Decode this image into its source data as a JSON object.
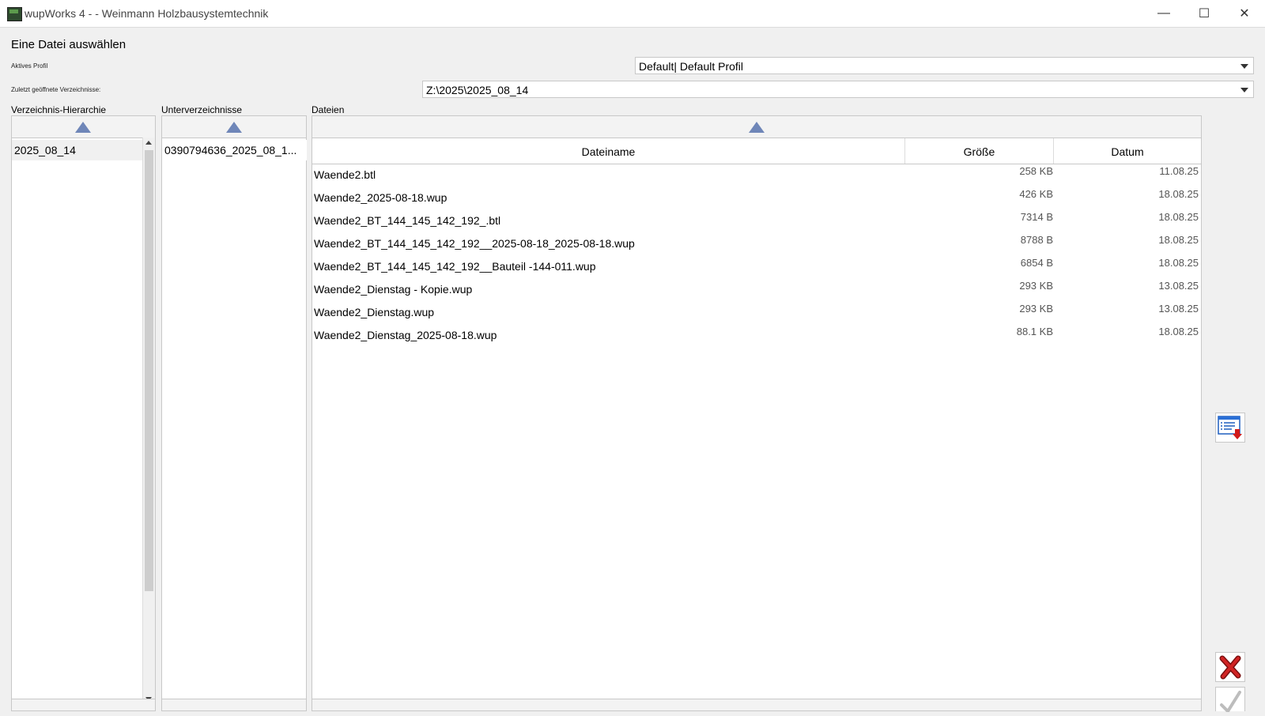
{
  "window": {
    "title": "wupWorks 4 -  - Weinmann Holzbausystemtechnik",
    "minimize_glyph": "—",
    "maximize_glyph": "☐",
    "close_glyph": "✕"
  },
  "dialog": {
    "title": "Eine Datei auswählen",
    "active_profile_label": "Aktives Profil",
    "active_profile_value": "Default| Default Profil",
    "recent_dirs_label": "Zuletzt geöffnete Verzeichnisse:",
    "recent_dir_value": "Z:\\2025\\2025_08_14"
  },
  "hierarchy": {
    "label": "Verzeichnis-Hierarchie",
    "items": [
      "2025_08_14"
    ]
  },
  "subdirs": {
    "label": "Unterverzeichnisse",
    "items": [
      "0390794636_2025_08_1..."
    ]
  },
  "files": {
    "label": "Dateien",
    "columns": {
      "name": "Dateiname",
      "size": "Größe",
      "date": "Datum"
    },
    "rows": [
      {
        "name": "Waende2.btl",
        "size": "258 KB",
        "date": "11.08.25"
      },
      {
        "name": "Waende2_2025-08-18.wup",
        "size": "426 KB",
        "date": "18.08.25"
      },
      {
        "name": "Waende2_BT_144_145_142_192_.btl",
        "size": "7314 B",
        "date": "18.08.25"
      },
      {
        "name": "Waende2_BT_144_145_142_192__2025-08-18_2025-08-18.wup",
        "size": "8788 B",
        "date": "18.08.25"
      },
      {
        "name": "Waende2_BT_144_145_142_192__Bauteil -144-011.wup",
        "size": "6854 B",
        "date": "18.08.25"
      },
      {
        "name": "Waende2_Dienstag - Kopie.wup",
        "size": "293 KB",
        "date": "13.08.25"
      },
      {
        "name": "Waende2_Dienstag.wup",
        "size": "293 KB",
        "date": "13.08.25"
      },
      {
        "name": "Waende2_Dienstag_2025-08-18.wup",
        "size": "88.1 KB",
        "date": "18.08.25"
      }
    ]
  },
  "icons": {
    "app": "app-icon",
    "list_download": "list-download-icon",
    "cancel": "red-x-icon",
    "ok": "checkmark-icon",
    "up": "up-triangle-icon"
  },
  "colors": {
    "up_arrow": "#6f86b8",
    "cancel_red": "#c81e1e",
    "download_red": "#d11a1a"
  }
}
